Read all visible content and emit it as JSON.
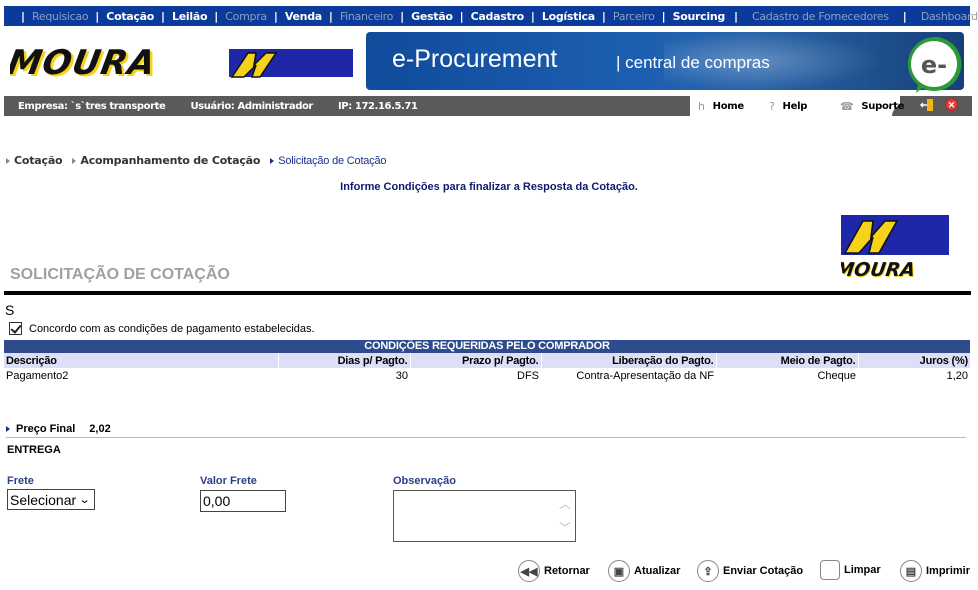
{
  "topnav": {
    "items": [
      {
        "label": "Requisicao",
        "enabled": false
      },
      {
        "label": "Cotação",
        "enabled": true
      },
      {
        "label": "Leilão",
        "enabled": true
      },
      {
        "label": "Compra",
        "enabled": false
      },
      {
        "label": "Venda",
        "enabled": true
      },
      {
        "label": "Financeiro",
        "enabled": false
      },
      {
        "label": "Gestão",
        "enabled": true
      },
      {
        "label": "Cadastro",
        "enabled": true
      },
      {
        "label": "Logística",
        "enabled": true
      },
      {
        "label": "Parceiro",
        "enabled": false
      },
      {
        "label": "Sourcing",
        "enabled": true
      },
      {
        "label": "Cadastro de Fornecedores",
        "enabled": false
      },
      {
        "label": "Dashboard",
        "enabled": false
      }
    ],
    "separator": "|"
  },
  "header": {
    "logo_text": "MOURA",
    "banner_title": "e-Procurement",
    "banner_subtitle": "| central de compras",
    "badge_text": "e-"
  },
  "infobar": {
    "empresa": "Empresa: `s`tres transporte",
    "usuario": "Usuário: Administrador",
    "ip": "IP: 172.16.5.71",
    "links": [
      {
        "icon": "home-icon",
        "glyph": "h",
        "label": "Home"
      },
      {
        "icon": "help-icon",
        "glyph": "?",
        "label": "Help"
      },
      {
        "icon": "phone-icon",
        "glyph": "☎",
        "label": "Suporte"
      }
    ],
    "close_glyph": "✕"
  },
  "breadcrumb": [
    {
      "label": "Cotação"
    },
    {
      "label": "Acompanhamento de Cotação"
    },
    {
      "label": "Solicitação de Cotação"
    }
  ],
  "instruction": "Informe Condições para finalizar a Resposta da Cotação.",
  "page_title": "SOLICITAÇÃO DE COTAÇÃO",
  "s_letter": "S",
  "agree": {
    "label": "Concordo com as condições de pagamento estabelecidas.",
    "checked": true
  },
  "conditions": {
    "caption": "CONDIÇÕES REQUERIDAS PELO COMPRADOR",
    "headers": [
      "Descrição",
      "Dias p/ Pagto.",
      "Prazo p/ Pagto.",
      "Liberação do Pagto.",
      "Meio de Pagto.",
      "Juros (%)"
    ],
    "rows": [
      [
        "Pagamento2",
        "30",
        "DFS",
        "Contra-Apresentação da NF",
        "Cheque",
        "1,20"
      ]
    ]
  },
  "price": {
    "label": "Preço Final",
    "value": "2,02"
  },
  "entrega": {
    "section_label": "ENTREGA",
    "frete_label": "Frete",
    "frete_selected": "Selecionar",
    "valor_frete_label": "Valor Frete",
    "valor_frete_value": "0,00",
    "observacao_label": "Observação",
    "observacao_value": ""
  },
  "actions": [
    {
      "label": "Retornar",
      "glyph": "◀◀"
    },
    {
      "label": "Atualizar",
      "glyph": "▣"
    },
    {
      "label": "Enviar Cotação",
      "glyph": "⇪"
    },
    {
      "label": "Limpar",
      "glyph": ""
    },
    {
      "label": "Imprimir",
      "glyph": "▤"
    }
  ]
}
